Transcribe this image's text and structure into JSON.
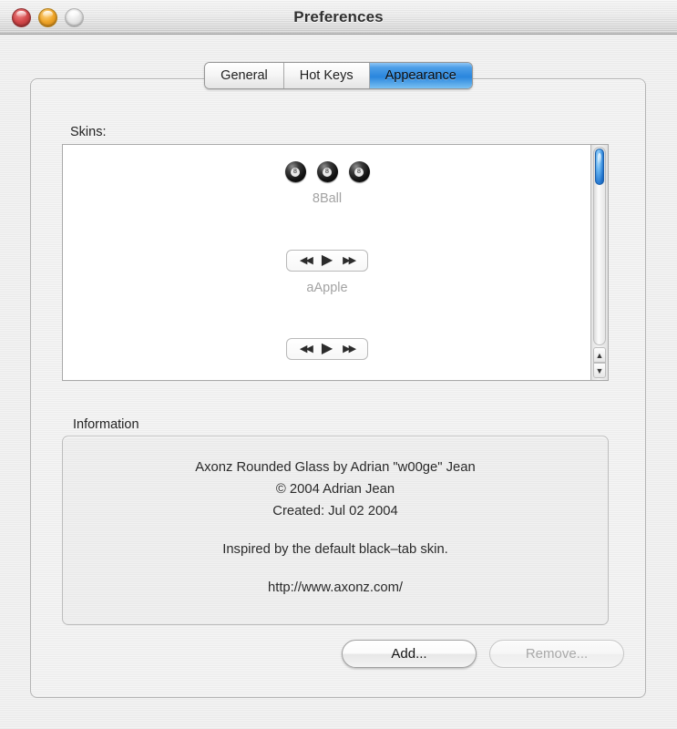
{
  "window": {
    "title": "Preferences",
    "traffic_lights": [
      {
        "name": "close",
        "color": "#d4494b"
      },
      {
        "name": "minimize",
        "color": "#f0a62a"
      },
      {
        "name": "zoom",
        "color": "#e6e6e6"
      }
    ]
  },
  "tabs": [
    {
      "label": "General",
      "selected": false
    },
    {
      "label": "Hot Keys",
      "selected": false
    },
    {
      "label": "Appearance",
      "selected": true
    }
  ],
  "skins": {
    "label": "Skins:",
    "items": [
      {
        "name": "8Ball",
        "preview": "eight-ball",
        "ball_digit": "8"
      },
      {
        "name": "aApple",
        "preview": "transport"
      },
      {
        "name": "",
        "preview": "transport"
      }
    ],
    "transport_glyphs": {
      "prev": "◀◀",
      "play": "▶",
      "next": "▶▶"
    },
    "scrollbar": {
      "up_arrow": "▲",
      "down_arrow": "▼"
    }
  },
  "information": {
    "label": "Information",
    "lines": [
      "Axonz Rounded Glass by Adrian \"w00ge\" Jean",
      "© 2004 Adrian Jean",
      "Created: Jul 02 2004"
    ],
    "note": "Inspired by the default black–tab skin.",
    "url": "http://www.axonz.com/"
  },
  "buttons": {
    "add": "Add...",
    "remove": "Remove..."
  },
  "colors": {
    "accent": "#2a86dd",
    "scrollbar_thumb": "#1f72cc",
    "window_bg": "#ededed"
  }
}
